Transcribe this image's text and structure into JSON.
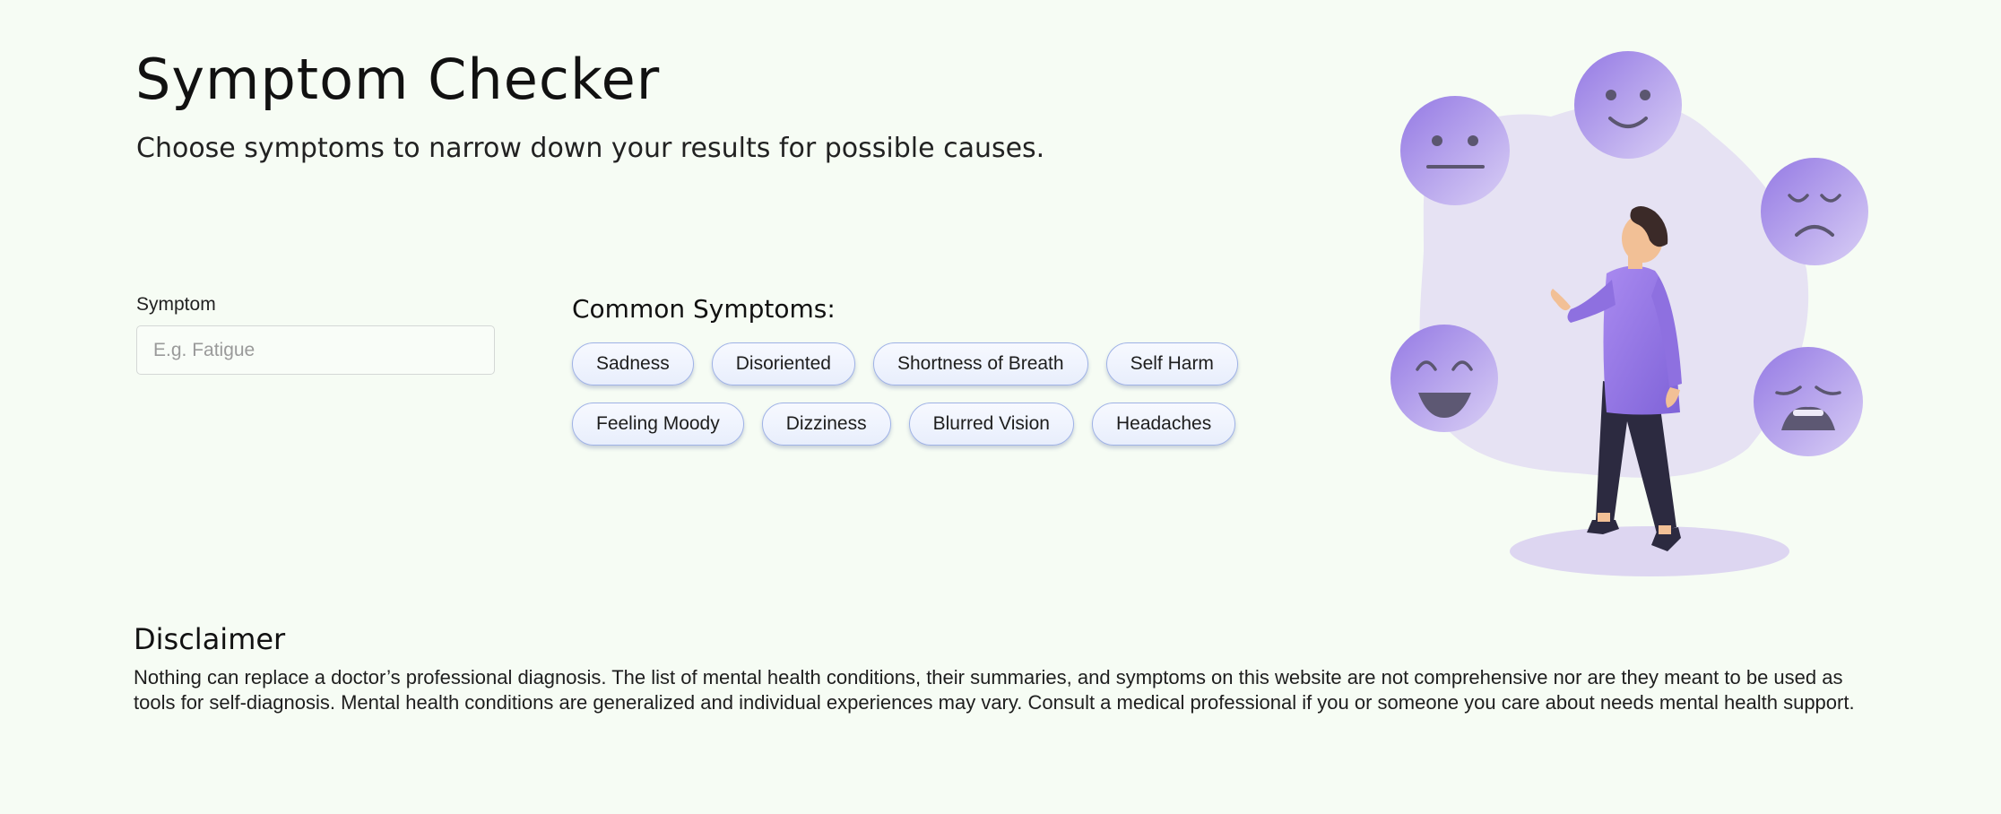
{
  "header": {
    "title": "Symptom Checker",
    "subtitle": "Choose symptoms to narrow down your results for possible causes."
  },
  "search": {
    "label": "Symptom",
    "placeholder": "E.g. Fatigue",
    "value": ""
  },
  "common_symptoms": {
    "heading": "Common Symptoms:",
    "rows": [
      [
        "Sadness",
        "Disoriented",
        "Shortness of Breath",
        "Self Harm"
      ],
      [
        "Feeling Moody",
        "Dizziness",
        "Blurred Vision",
        "Headaches"
      ]
    ]
  },
  "disclaimer": {
    "heading": "Disclaimer",
    "text": "Nothing can replace a doctor’s professional diagnosis. The list of mental health conditions, their summaries, and symptoms on this website are not comprehensive nor are they meant to be used as tools for self-diagnosis. Mental health conditions are generalized and individual experiences may vary. Consult a medical professional if you or someone you care about needs mental health support."
  },
  "illustration": {
    "icons": [
      "neutral-face-icon",
      "slight-smile-face-icon",
      "sad-face-icon",
      "laughing-face-icon",
      "crying-face-icon",
      "person-figure"
    ]
  },
  "colors": {
    "background": "#f6fcf4",
    "accent_purple": "#9b7fe6",
    "blob": "#e6e2f3",
    "chip_border": "#9fb2e6"
  }
}
